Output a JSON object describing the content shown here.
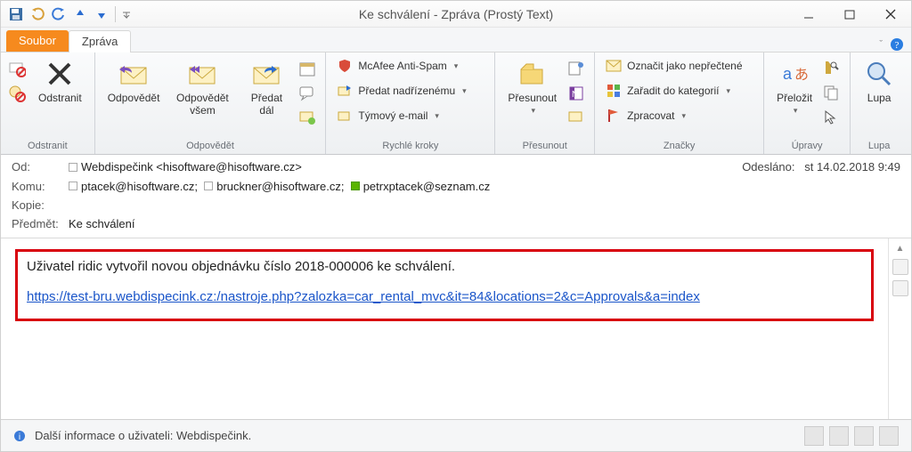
{
  "window": {
    "title": "Ke schválení - Zpráva (Prostý Text)"
  },
  "tabs": {
    "file": "Soubor",
    "message": "Zpráva"
  },
  "ribbon": {
    "delete_group": "Odstranit",
    "delete": "Odstranit",
    "respond_group": "Odpovědět",
    "reply": "Odpovědět",
    "reply_all": "Odpovědět všem",
    "forward": "Předat dál",
    "quick_group": "Rychlé kroky",
    "quick_antispam": "McAfee Anti-Spam",
    "quick_supervisor": "Předat nadřízenému",
    "quick_team": "Týmový e-mail",
    "move_group": "Přesunout",
    "move": "Přesunout",
    "tags_group": "Značky",
    "mark_unread": "Označit jako nepřečtené",
    "categorize": "Zařadit do kategorií",
    "follow_up": "Zpracovat",
    "editing_group": "Úpravy",
    "translate": "Přeložit",
    "zoom_group": "Lupa",
    "zoom": "Lupa"
  },
  "headers": {
    "from_label": "Od:",
    "from_value": "Webdispečink <hisoftware@hisoftware.cz>",
    "sent_label": "Odesláno:",
    "sent_value": "st 14.02.2018 9:49",
    "to_label": "Komu:",
    "to_values": [
      "ptacek@hisoftware.cz;",
      "bruckner@hisoftware.cz;",
      "petrxptacek@seznam.cz"
    ],
    "cc_label": "Kopie:",
    "subject_label": "Předmět:",
    "subject_value": "Ke schválení"
  },
  "body": {
    "line1": "Uživatel ridic vytvořil novou objednávku číslo 2018-000006 ke schválení.",
    "link": "https://test-bru.webdispecink.cz:/nastroje.php?zalozka=car_rental_mvc&it=84&locations=2&c=Approvals&a=index"
  },
  "status": {
    "info": "Další informace o uživateli: Webdispečink."
  }
}
